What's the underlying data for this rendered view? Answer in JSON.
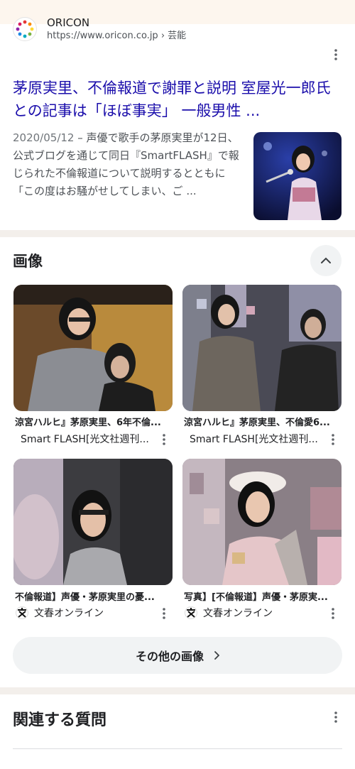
{
  "result": {
    "source_name": "ORICON",
    "source_url": "https://www.oricon.co.jp › 芸能",
    "title": "茅原実里、不倫報道で謝罪と説明 室屋光一郎氏との記事は「ほぼ事実」 一般男性 ...",
    "date": "2020/05/12",
    "snippet": " – 声優で歌手の茅原実里が12日、公式ブログを通じて同日『SmartFLASH』で報じられた不倫報道について説明するとともに「この度はお騒がせしてしまい、ご ..."
  },
  "images": {
    "section_title": "画像",
    "tiles": [
      {
        "caption": "涼宮ハルヒ』茅原実里、6年不倫...",
        "source": "Smart FLASH[光文社週刊..."
      },
      {
        "caption": "涼宮ハルヒ』茅原実里、不倫愛6...",
        "source": "Smart FLASH[光文社週刊..."
      },
      {
        "caption": "不倫報道】声優・茅原実里の憂...",
        "source": "文春オンライン"
      },
      {
        "caption": "写真】[不倫報道】声優・茅原実...",
        "source": "文春オンライン"
      }
    ],
    "more_label": "その他の画像"
  },
  "paa": {
    "title": "関連する質問"
  },
  "colors": {
    "link": "#1a0dab",
    "page_bg": "#fdf6ee",
    "chip_bg": "#f1f3f4"
  }
}
